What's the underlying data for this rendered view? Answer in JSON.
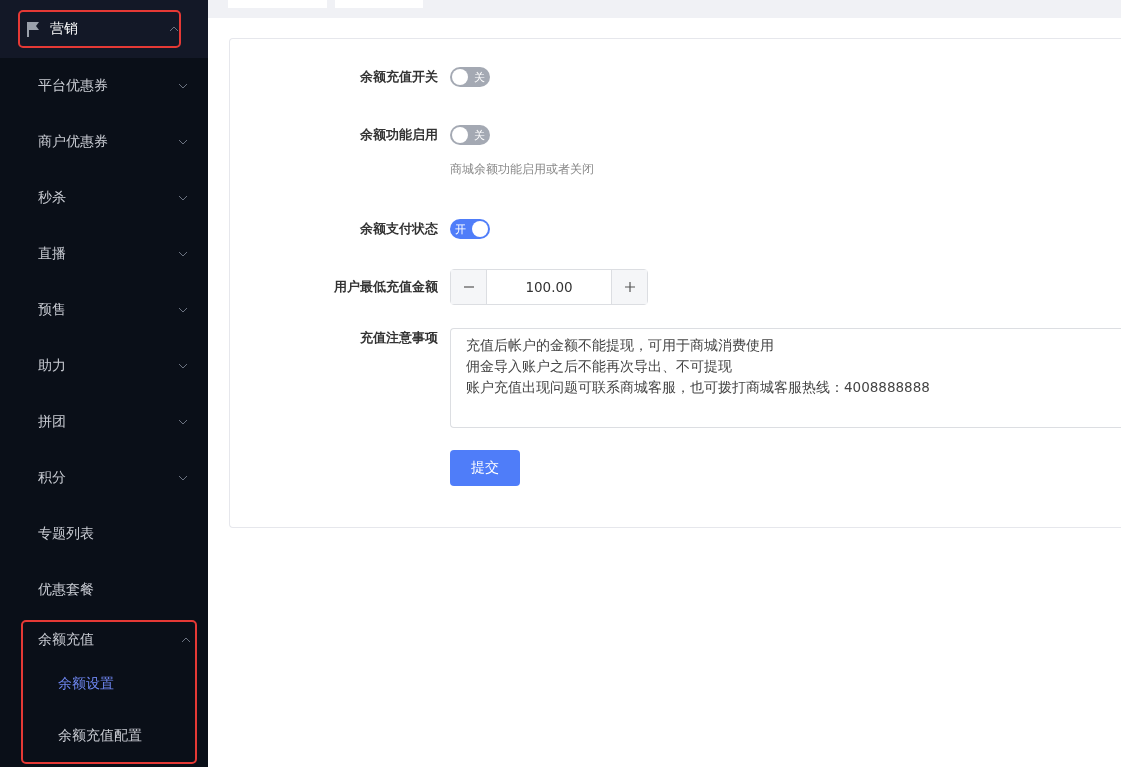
{
  "sidebar": {
    "menu": {
      "title": "营销",
      "expanded": true,
      "highlighted": true,
      "items": [
        {
          "label": "平台优惠券",
          "kind": "group",
          "expanded": false,
          "highlighted": false
        },
        {
          "label": "商户优惠券",
          "kind": "group",
          "expanded": false,
          "highlighted": false
        },
        {
          "label": "秒杀",
          "kind": "group",
          "expanded": false,
          "highlighted": false
        },
        {
          "label": "直播",
          "kind": "group",
          "expanded": false,
          "highlighted": false
        },
        {
          "label": "预售",
          "kind": "group",
          "expanded": false,
          "highlighted": false
        },
        {
          "label": "助力",
          "kind": "group",
          "expanded": false,
          "highlighted": false
        },
        {
          "label": "拼团",
          "kind": "group",
          "expanded": false,
          "highlighted": false
        },
        {
          "label": "积分",
          "kind": "group",
          "expanded": false,
          "highlighted": false
        },
        {
          "label": "专题列表",
          "kind": "link",
          "highlighted": false
        },
        {
          "label": "优惠套餐",
          "kind": "link",
          "highlighted": false
        },
        {
          "label": "余额充值",
          "kind": "group",
          "expanded": true,
          "highlighted": true,
          "children": [
            {
              "label": "余额设置",
              "selected": true
            },
            {
              "label": "余额充值配置",
              "selected": false
            }
          ]
        }
      ]
    }
  },
  "form": {
    "fields": [
      {
        "kind": "switch",
        "label": "余额充值开关",
        "on": false,
        "text": "关"
      },
      {
        "kind": "switch",
        "label": "余额功能启用",
        "on": false,
        "text": "关",
        "hint": "商城余额功能启用或者关闭"
      },
      {
        "kind": "switch",
        "label": "余额支付状态",
        "on": true,
        "text": "开"
      },
      {
        "kind": "stepper",
        "label": "用户最低充值金额",
        "value": "100.00"
      },
      {
        "kind": "textarea",
        "label": "充值注意事项",
        "lines": [
          "充值后帐户的金额不能提现，可用于商城消费使用",
          "佣金导入账户之后不能再次导出、不可提现",
          "账户充值出现问题可联系商城客服，也可拨打商城客服热线：4008888888"
        ]
      }
    ],
    "submit": "提交"
  }
}
